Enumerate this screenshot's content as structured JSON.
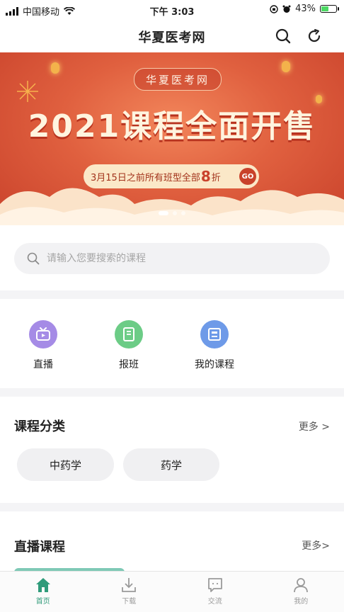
{
  "status_bar": {
    "carrier": "中国移动",
    "time": "下午 3:03",
    "battery": "43%"
  },
  "nav": {
    "title": "华夏医考网",
    "icons": [
      "search-icon",
      "refresh-icon"
    ]
  },
  "banner": {
    "logo_text": "华夏医考网",
    "headline": "2021课程全面开售",
    "promo_prefix": "3月15日之前所有班型全部",
    "promo_number": "8",
    "promo_suffix": "折",
    "promo_button": "GO",
    "slide_count": 3,
    "active_slide": 1
  },
  "search": {
    "placeholder": "请输入您要搜索的课程"
  },
  "quick_actions": [
    {
      "label": "直播",
      "icon": "tv-icon",
      "color": "#a58be6"
    },
    {
      "label": "报班",
      "icon": "book-icon",
      "color": "#6ccc86"
    },
    {
      "label": "我的课程",
      "icon": "course-list-icon",
      "color": "#6e9ae8"
    }
  ],
  "course_category": {
    "title": "课程分类",
    "more": "更多 >",
    "chips": [
      "中药学",
      "药学"
    ]
  },
  "live_courses": {
    "title": "直播课程",
    "more": "更多>"
  },
  "tabbar": {
    "tabs": [
      {
        "label": "首页",
        "icon": "home-icon",
        "active": true
      },
      {
        "label": "下载",
        "icon": "download-icon",
        "active": false
      },
      {
        "label": "交流",
        "icon": "chat-icon",
        "active": false
      },
      {
        "label": "我的",
        "icon": "user-icon",
        "active": false
      }
    ]
  },
  "colors": {
    "accent": "#2f9b7a",
    "banner_red": "#e0603f"
  }
}
